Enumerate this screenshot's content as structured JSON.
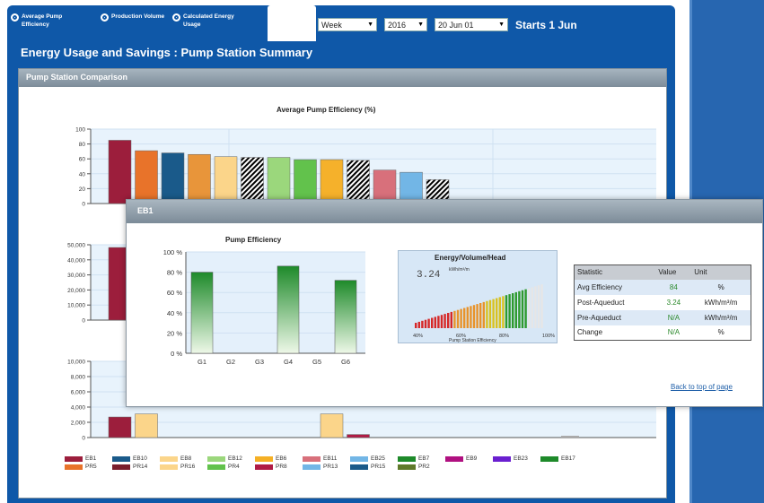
{
  "options": [
    {
      "label": "Average Pump Efficiency"
    },
    {
      "label": "Production Volume"
    },
    {
      "label": "Calculated Energy Usage"
    }
  ],
  "controls": {
    "period": "Week",
    "year": "2016",
    "date": "20 Jun 01",
    "starts": "Starts 1 Jun"
  },
  "page_title": "Energy Usage and Savings : Pump Station Summary",
  "panel_title": "Pump Station Comparison",
  "chart_data": [
    {
      "type": "bar",
      "title": "Average Pump Efficiency (%)",
      "ylim": [
        0,
        100
      ],
      "yticks": [
        "100",
        "80",
        "60",
        "40",
        "20",
        "0"
      ],
      "values": [
        85,
        71,
        68,
        66,
        63,
        62,
        62,
        59,
        59,
        58,
        45,
        42,
        32
      ],
      "colors": [
        "#9c1e3c",
        "#e8732a",
        "#1a5a8a",
        "#e8953a",
        "#fbd58a",
        "#f5b025",
        "#9bd77c",
        "#62c24c",
        "#f5b12b",
        "#b01b45",
        "#d8707b",
        "#72b6e6",
        "#3f7fd4"
      ],
      "patterns": [
        false,
        false,
        false,
        false,
        false,
        true,
        false,
        false,
        false,
        true,
        false,
        false,
        true
      ]
    },
    {
      "type": "bar",
      "title": "",
      "ylim": [
        0,
        50000
      ],
      "yticks": [
        "50,000",
        "40,000",
        "30,000",
        "20,000",
        "10,000",
        "0"
      ]
    },
    {
      "type": "bar",
      "title": "",
      "ylim": [
        0,
        10000
      ],
      "yticks": [
        "10,000",
        "8,000",
        "6,000",
        "4,000",
        "2,000",
        "0"
      ],
      "values": [
        2700,
        3100,
        0,
        0,
        0,
        0,
        0,
        0,
        3100,
        400
      ],
      "colors": [
        "#9c1e3c",
        "#fbd58a",
        "#fff",
        "#fff",
        "#fff",
        "#fff",
        "#fff",
        "#fff",
        "#fbd58a",
        "#b01b45"
      ]
    },
    {
      "type": "bar",
      "title": "Pump Efficiency",
      "categories": [
        "G1",
        "G2",
        "G3",
        "G4",
        "G5",
        "G6"
      ],
      "values": [
        80,
        0,
        0,
        86,
        0,
        72
      ],
      "ylim": [
        0,
        100
      ],
      "yticks": [
        "100 %",
        "80 %",
        "60 %",
        "40 %",
        "20 %",
        "0 %"
      ]
    }
  ],
  "gauge": {
    "title": "Energy/Volume/Head",
    "value": "3.24",
    "unit": "kWh/m³/m",
    "labels": [
      "40%",
      "60%",
      "80%",
      "100%"
    ],
    "axis_label": "Pump Station Efficiency"
  },
  "popup": {
    "title": "EB1",
    "table": {
      "headers": [
        "Statistic",
        "Value",
        "Unit"
      ],
      "rows": [
        [
          "Avg Efficiency",
          "84",
          "%"
        ],
        [
          "Post-Aqueduct",
          "3.24",
          "kWh/m³/m"
        ],
        [
          "Pre-Aqueduct",
          "N/A",
          "kWh/m³/m"
        ],
        [
          "Change",
          "N/A",
          "%"
        ]
      ]
    },
    "back_link": "Back to top of page"
  },
  "legend": [
    {
      "label": "EB1",
      "color": "#9c1e3c"
    },
    {
      "label": "EB10",
      "color": "#1a5a8a"
    },
    {
      "label": "EB8",
      "color": "#fbd58a"
    },
    {
      "label": "EB12",
      "color": "#9bd77c"
    },
    {
      "label": "EB6",
      "color": "#f5b025"
    },
    {
      "label": "EB11",
      "color": "#d8707b"
    },
    {
      "label": "EB25",
      "color": "#72b6e6"
    },
    {
      "label": "EB7",
      "color": "#1e8a2a"
    },
    {
      "label": "EB9",
      "color": "#b01080"
    },
    {
      "label": "EB23",
      "color": "#6a1fd0"
    },
    {
      "label": "EB17",
      "color": "#1e8a2a"
    },
    {
      "label": "PR5",
      "color": "#e8732a"
    },
    {
      "label": "PR14",
      "color": "#7a1e2c"
    },
    {
      "label": "PR16",
      "color": "#fbd58a"
    },
    {
      "label": "PR4",
      "color": "#62c24c"
    },
    {
      "label": "PR8",
      "color": "#b01b45"
    },
    {
      "label": "PR13",
      "color": "#72b6e6"
    },
    {
      "label": "PR15",
      "color": "#1a5a8a"
    },
    {
      "label": "PR2",
      "color": "#5f7a2a"
    }
  ]
}
